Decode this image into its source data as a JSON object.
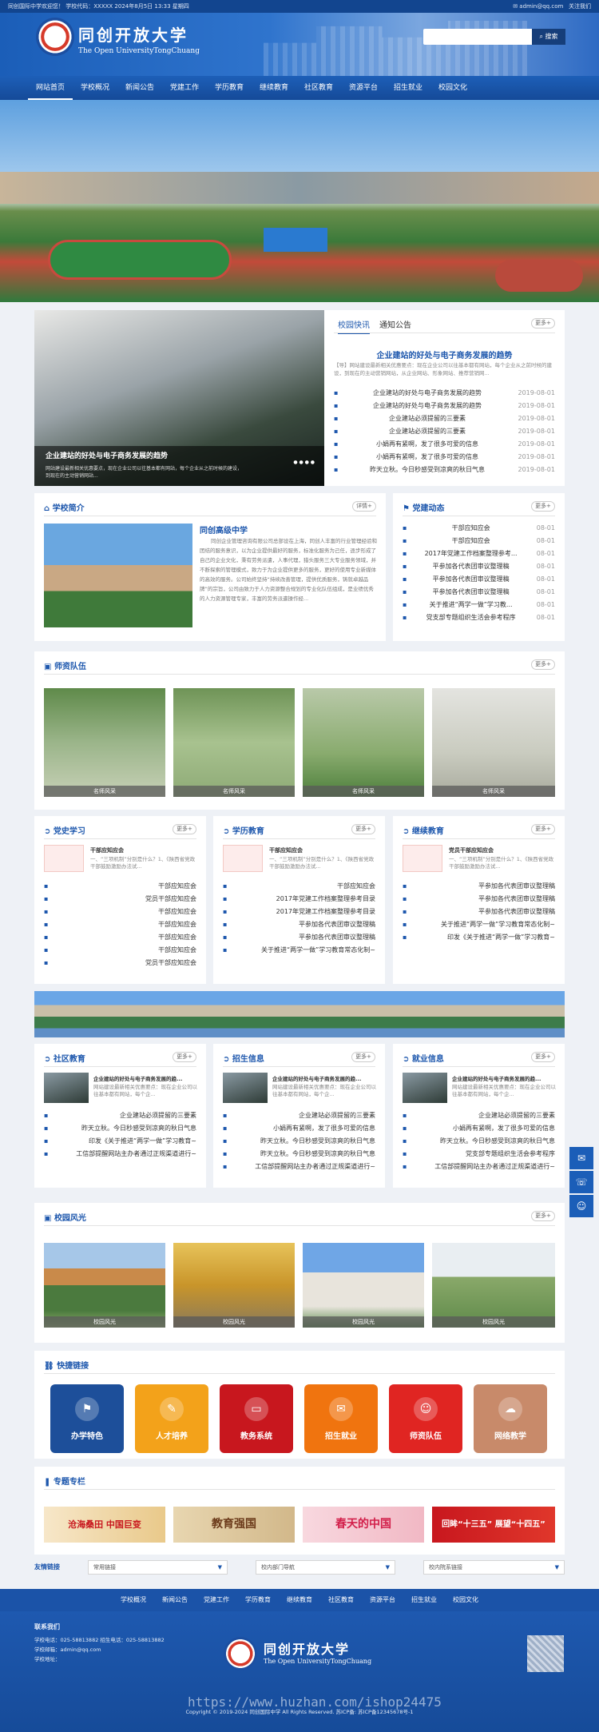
{
  "topbar": {
    "left": "同创国际中学欢迎您！ 学校代码：XXXXX  2024年8月5日 13:33 星期四",
    "email": "✉ admin@qq.com",
    "follow": "关注我们"
  },
  "header": {
    "school_cn": "同创开放大学",
    "school_en": "The Open UniversityTongChuang",
    "search_placeholder": "",
    "search_btn": "搜索"
  },
  "nav": [
    "网站首页",
    "学校概况",
    "新闻公告",
    "党建工作",
    "学历教育",
    "继续教育",
    "社区教育",
    "资源平台",
    "招生就业",
    "校园文化"
  ],
  "slider": {
    "caption": "企业建站的好处与电子商务发展的趋势",
    "desc": "网站建设最新相关优惠要点，现在企业公司以往基本都有网站，每个企业从之前时候的建设，到现在的主动营销网站..."
  },
  "news": {
    "tab1": "校园快讯",
    "tab2": "通知公告",
    "more": "更多+",
    "headline": "企业建站的好处与电子商务发展的趋势",
    "summary": "【导】网站建设最新相关优惠要点：现在企业公司以往基本都有网站，每个企业从之前时候的建设，到现在的主动营销网站，从企业网站、形象网站、推荐营销网...",
    "items": [
      {
        "t": "企业建站的好处与电子商务发展的趋势",
        "d": "2019-08-01"
      },
      {
        "t": "企业建站的好处与电子商务发展的趋势",
        "d": "2019-08-01"
      },
      {
        "t": "企业建站必须提留的三要素",
        "d": "2019-08-01"
      },
      {
        "t": "企业建站必须提留的三要素",
        "d": "2019-08-01"
      },
      {
        "t": "小娟再有紧啊，发了很多可爱的信息",
        "d": "2019-08-01"
      },
      {
        "t": "小娟再有紧啊，发了很多可爱的信息",
        "d": "2019-08-01"
      },
      {
        "t": "昨天立秋。今日秒感受到凉爽的秋日气息",
        "d": "2019-08-01"
      }
    ]
  },
  "intro": {
    "title": "学校简介",
    "more": "详情+",
    "name": "同创高级中学",
    "text": "同创企业管理咨询有限公司总部设在上海，同创人丰富的行业管理经验和团结的服务意识，以为企业提供最好的服务，标准化服务为己任，逐步形成了自己的企业文化，秉有劳务派遣，人事代理，猎头服务三大专业服务领域，并不断探索的管理模式，致力于为企业提供更多的服务，更好的使用专业新媒体的高效的服务。公司始终坚持“持续改善管理，提供优质服务，铸就卓越品牌”的宗旨，公司由致力于人力资源整合规划的专业化队伍组成，是业绩优秀的人力资源管理专家，丰富的劳务派遣操作经..."
  },
  "party": {
    "title": "党建动态",
    "more": "更多+",
    "items": [
      {
        "t": "干部应知应会",
        "d": "08-01"
      },
      {
        "t": "干部应知应会",
        "d": "08-01"
      },
      {
        "t": "2017年党建工作档案整理参考...",
        "d": "08-01"
      },
      {
        "t": "平参加各代表团审议整理稿",
        "d": "08-01"
      },
      {
        "t": "平参加各代表团审议整理稿",
        "d": "08-01"
      },
      {
        "t": "平参加各代表团审议整理稿",
        "d": "08-01"
      },
      {
        "t": "关于推进“两学一做”学习教...",
        "d": "08-01"
      },
      {
        "t": "党支部专题组织生活会参考程序",
        "d": "08-01"
      }
    ]
  },
  "teachers": {
    "title": "师资队伍",
    "more": "更多+",
    "items": [
      "名师风采",
      "名师风采",
      "名师风采",
      "名师风采"
    ]
  },
  "cols3": [
    {
      "title": "党史学习",
      "more": "更多+",
      "ft": "干部应知应会",
      "fd": "一、“三项机制”分别是什么？1、《陕西省党政干部鼓励激励办法试...",
      "items": [
        "干部应知应会",
        "党员干部应知应会",
        "干部应知应会",
        "干部应知应会",
        "干部应知应会",
        "干部应知应会",
        "党员干部应知应会"
      ]
    },
    {
      "title": "学历教育",
      "more": "更多+",
      "ft": "干部应知应会",
      "fd": "一、“三项机制”分别是什么？1、《陕西省党政干部鼓励激励办法试...",
      "items": [
        "干部应知应会",
        "2017年党建工作档案整理参考目录",
        "2017年党建工作档案整理参考目录",
        "平参加各代表团审议整理稿",
        "平参加各代表团审议整理稿",
        "关于推进“两学一做”学习教育常态化制~"
      ]
    },
    {
      "title": "继续教育",
      "more": "更多+",
      "ft": "党员干部应知应会",
      "fd": "一、“三项机制”分别是什么？1、《陕西省党政干部鼓励激励办法试...",
      "items": [
        "平参加各代表团审议整理稿",
        "平参加各代表团审议整理稿",
        "平参加各代表团审议整理稿",
        "关于推进“两学一做”学习教育常态化制~",
        "印发《关于推进“两学一做”学习教育~"
      ]
    }
  ],
  "cols3b": [
    {
      "title": "社区教育",
      "more": "更多+",
      "ft": "企业建站的好处与电子商务发展的趋...",
      "fd": "网站建设最新相关优惠要点：现在企业公司以往基本都有网站，每个企...",
      "items": [
        "企业建站必须提留的三要素",
        "昨天立秋。今日秒感受到凉爽的秋日气息",
        "印发《关于推进“两学一做”学习教育~",
        "工信部提醒网站主办者通过正规渠道进行~"
      ]
    },
    {
      "title": "招生信息",
      "more": "更多+",
      "ft": "企业建站的好处与电子商务发展的趋...",
      "fd": "网站建设最新相关优惠要点：现在企业公司以往基本都有网站，每个企...",
      "items": [
        "企业建站必须提留的三要素",
        "小娟再有紧啊，发了很多可爱的信息",
        "昨天立秋。今日秒感受到凉爽的秋日气息",
        "昨天立秋。今日秒感受到凉爽的秋日气息",
        "工信部提醒网站主办者通过正规渠道进行~"
      ]
    },
    {
      "title": "就业信息",
      "more": "更多+",
      "ft": "企业建站的好处与电子商务发展的趋...",
      "fd": "网站建设最新相关优惠要点：现在企业公司以往基本都有网站，每个企...",
      "items": [
        "企业建站必须提留的三要素",
        "小娟再有紧啊，发了很多可爱的信息",
        "昨天立秋。今日秒感受到凉爽的秋日气息",
        "党支部专题组织生活会参考程序",
        "工信部提醒网站主办者通过正规渠道进行~"
      ]
    }
  ],
  "campus": {
    "title": "校园风光",
    "more": "更多+",
    "items": [
      "校园风光",
      "校园风光",
      "校园风光",
      "校园风光"
    ]
  },
  "quick": {
    "title": "快捷链接",
    "items": [
      {
        "label": "办学特色",
        "color": "#1d4f9a",
        "icon": "⚑"
      },
      {
        "label": "人才培养",
        "color": "#f3a21a",
        "icon": "✎"
      },
      {
        "label": "教务系统",
        "color": "#c8171e",
        "icon": "▭"
      },
      {
        "label": "招生就业",
        "color": "#f0740f",
        "icon": "✉"
      },
      {
        "label": "师资队伍",
        "color": "#e02522",
        "icon": "☺"
      },
      {
        "label": "网络教学",
        "color": "#c88a6a",
        "icon": "☁"
      }
    ]
  },
  "special": {
    "title": "专题专栏",
    "items": [
      "沧海桑田 中国巨变",
      "教育强国",
      "春天的中国",
      "回眸“十三五” 展望“十四五”"
    ]
  },
  "links": {
    "label": "友情链接",
    "selects": [
      "常用链接",
      "校内部门导航",
      "校内院系链接"
    ]
  },
  "footnav": [
    "学校概况",
    "新闻公告",
    "党建工作",
    "学历教育",
    "继续教育",
    "社区教育",
    "资源平台",
    "招生就业",
    "校园文化"
  ],
  "footer": {
    "contact_title": "联系我们",
    "phone": "学校电话：025-58813882  招生电话：025-58813882",
    "email": "学校邮箱：admin@qq.com",
    "addr": "学校地址：",
    "school_cn": "同创开放大学",
    "school_en": "The Open UniversityTongChuang",
    "copyright": "Copyright © 2019-2024 同创国际中学 All Rights Reserved. 苏ICP备: 苏ICP备12345678号-1",
    "watermark": "https://www.huzhan.com/ishop24475"
  }
}
